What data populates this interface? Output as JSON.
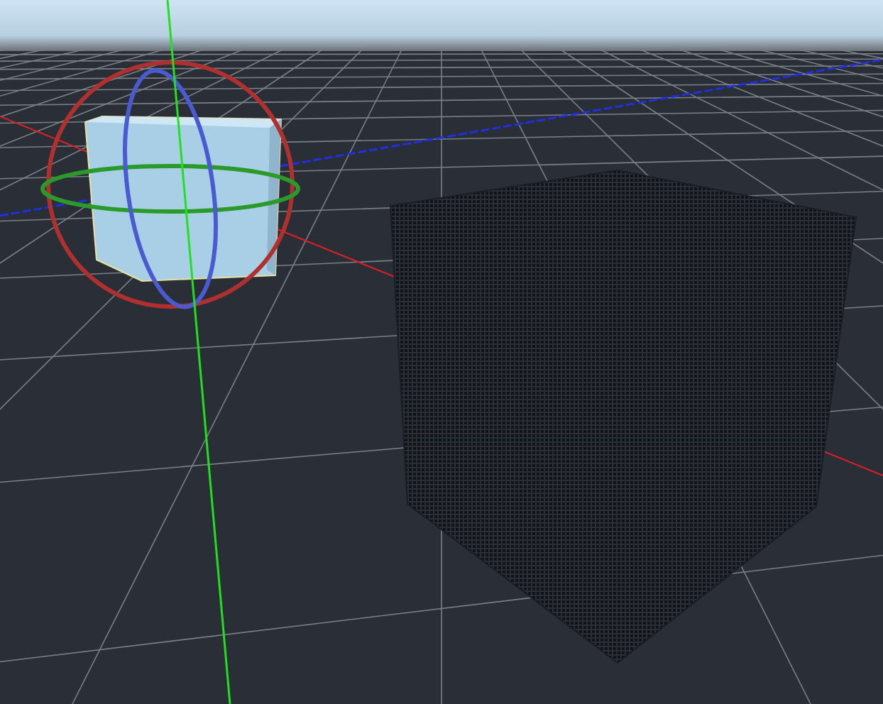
{
  "viewport": {
    "objects": [
      {
        "kind": "cube",
        "selected": true
      },
      {
        "kind": "cube",
        "selected": false
      }
    ]
  }
}
